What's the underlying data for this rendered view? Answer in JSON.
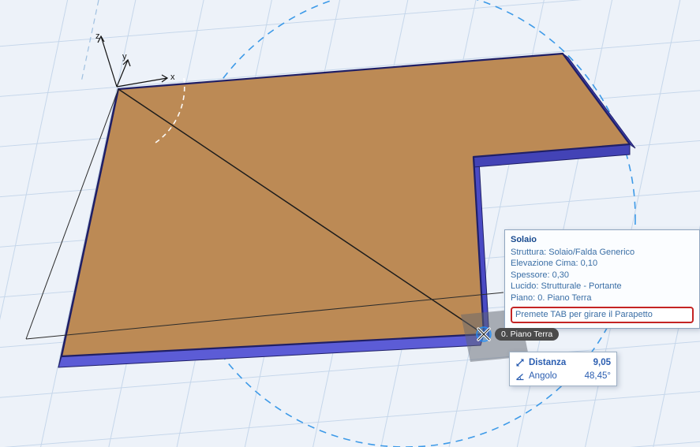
{
  "colors": {
    "background": "#edf2f9",
    "grid_line": "#c5d6ea",
    "slab_top": "#bc8a55",
    "slab_front_face": "#5c5cd6",
    "slab_right_face": "#4a4ac4",
    "slab_left_face": "#86827a",
    "slab_edge": "#1f1f66",
    "guide_circle": "#3d9ae8",
    "tooltip_text": "#3a6ea5",
    "tooltip_title": "#17498e",
    "hint_border": "#c42424",
    "tracker_text": "#2a5db0",
    "pill_bg": "#4b4b4b"
  },
  "axes": {
    "z_label": "z",
    "y_label": "y",
    "x_label": "x"
  },
  "tooltip": {
    "title": "Solaio",
    "lines": [
      "Struttura: Solaio/Falda Generico",
      "Elevazione Cima: 0,10",
      "Spessore: 0,30",
      "Lucido: Strutturale - Portante",
      "Piano: 0. Piano Terra"
    ],
    "hint": "Premete TAB per girare il Parapetto"
  },
  "story_tag": {
    "label": "0. Piano Terra"
  },
  "tracker": {
    "rows": [
      {
        "icon": "distance-icon",
        "label": "Distanza",
        "value": "9,05"
      },
      {
        "icon": "angle-icon",
        "label": "Angolo",
        "value": "48,45°"
      }
    ]
  }
}
